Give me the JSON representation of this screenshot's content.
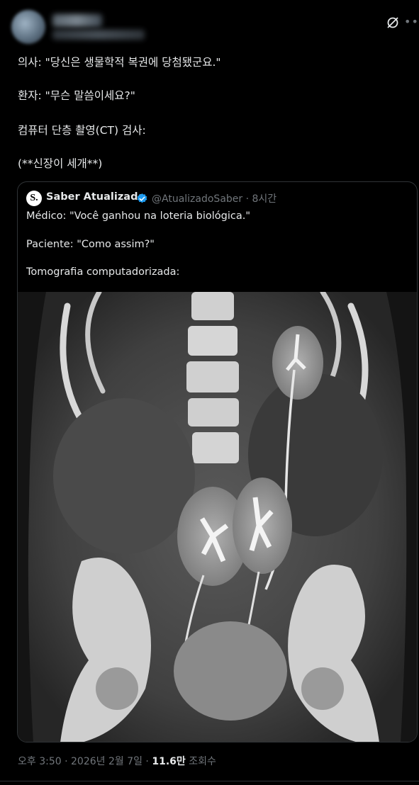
{
  "post": {
    "lines": [
      "의사: \"당신은 생물학적 복권에 당첨됐군요.\"",
      "환자: \"무슨 말씀이세요?\"",
      "컴퓨터 단층 촬영(CT) 검사:",
      "(**신장이 세개**)"
    ]
  },
  "quote": {
    "author_name": "Saber Atualizado",
    "handle_time": "@AtualizadoSaber · 8시간",
    "logo_text": "S.",
    "lines": [
      "Médico: \"Você ganhou na loteria biológica.\"",
      "Paciente: \"Como assim?\"",
      "Tomografia computadorizada:"
    ],
    "image_icon": "ct-scan-image"
  },
  "meta": {
    "time_date": "오후 3:50 · 2026년 2월 7일 · ",
    "views_count": "11.6만",
    "views_label": " 조회수"
  },
  "icons": {
    "grok": "grok-icon",
    "more": "more-options-icon",
    "verified": "verified-badge-icon"
  },
  "colors": {
    "background": "#000000",
    "text": "#e7e9ea",
    "muted": "#71767b",
    "border": "#2f3336",
    "verified": "#1d9bf0"
  }
}
